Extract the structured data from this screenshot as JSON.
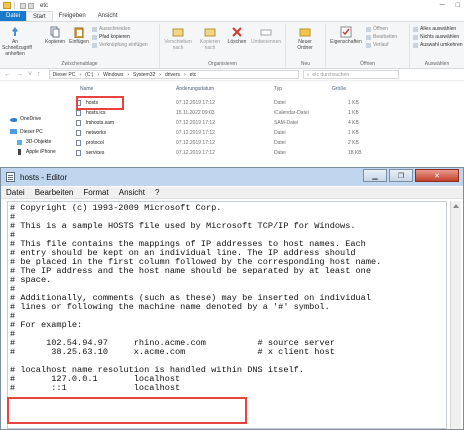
{
  "explorer": {
    "title_path": "etc",
    "ribbon_tabs": [
      "Datei",
      "Start",
      "Freigeben",
      "Ansicht"
    ],
    "ribbon": {
      "pin_label": "An Schnellzugriff anheften",
      "copy_label": "Kopieren",
      "paste_label": "Einfügen",
      "cut_label": "Ausschneiden",
      "copy_path_label": "Pfad kopieren",
      "paste_shortcut_label": "Verknüpfung einfügen",
      "clipboard_group": "Zwischenablage",
      "move_to_label": "Verschieben nach",
      "copy_to_label": "Kopieren nach",
      "delete_label": "Löschen",
      "rename_label": "Umbenennen",
      "organize_group": "Organisieren",
      "new_folder_label": "Neuer Ordner",
      "new_group": "Neu",
      "properties_label": "Eigenschaften",
      "open_label": "Öffnen",
      "edit_label": "Bearbeiten",
      "history_label": "Verlauf",
      "open_group": "Öffnen",
      "select_all_label": "Alles auswählen",
      "select_none_label": "Nichts auswählen",
      "invert_selection_label": "Auswahl umkehren",
      "select_group": "Auswählen"
    },
    "address": {
      "crumbs": [
        "Dieser PC",
        "(C:)",
        "Windows",
        "System32",
        "drivers",
        "etc"
      ],
      "search_placeholder": "etc durchsuchen"
    },
    "nav": {
      "onedrive": "OneDrive",
      "this_pc": "Dieser PC",
      "objects3d": "3D-Objekte",
      "iphone": "Apple iPhone"
    },
    "columns": {
      "name": "Name",
      "date": "Änderungsdatum",
      "type": "Typ",
      "size": "Größe"
    },
    "files": [
      {
        "name": "hosts",
        "date": "07.12.2019 17:12",
        "type": "Datei",
        "size": "1 KB"
      },
      {
        "name": "hosts.ics",
        "date": "15.11.2022 09:03",
        "type": "iCalendar-Datei",
        "size": "1 KB"
      },
      {
        "name": "lmhosts.sam",
        "date": "07.12.2019 17:12",
        "type": "SAM-Datei",
        "size": "4 KB"
      },
      {
        "name": "networks",
        "date": "07.12.2019 17:12",
        "type": "Datei",
        "size": "1 KB"
      },
      {
        "name": "protocol",
        "date": "07.12.2019 17:12",
        "type": "Datei",
        "size": "2 KB"
      },
      {
        "name": "services",
        "date": "07.12.2019 17:12",
        "type": "Datei",
        "size": "18 KB"
      }
    ]
  },
  "notepad": {
    "title": "hosts - Editor",
    "menu": [
      "Datei",
      "Bearbeiten",
      "Format",
      "Ansicht",
      "?"
    ],
    "lines": [
      "# Copyright (c) 1993-2009 Microsoft Corp.",
      "#",
      "# This is a sample HOSTS file used by Microsoft TCP/IP for Windows.",
      "#",
      "# This file contains the mappings of IP addresses to host names. Each",
      "# entry should be kept on an individual line. The IP address should",
      "# be placed in the first column followed by the corresponding host name.",
      "# The IP address and the host name should be separated by at least one",
      "# space.",
      "#",
      "# Additionally, comments (such as these) may be inserted on individual",
      "# lines or following the machine name denoted by a '#' symbol.",
      "#",
      "# For example:",
      "#",
      "#      102.54.94.97     rhino.acme.com          # source server",
      "#       38.25.63.10     x.acme.com              # x client host",
      "",
      "# localhost name resolution is handled within DNS itself.",
      "#\t127.0.0.1       localhost",
      "#\t::1             localhost"
    ]
  }
}
